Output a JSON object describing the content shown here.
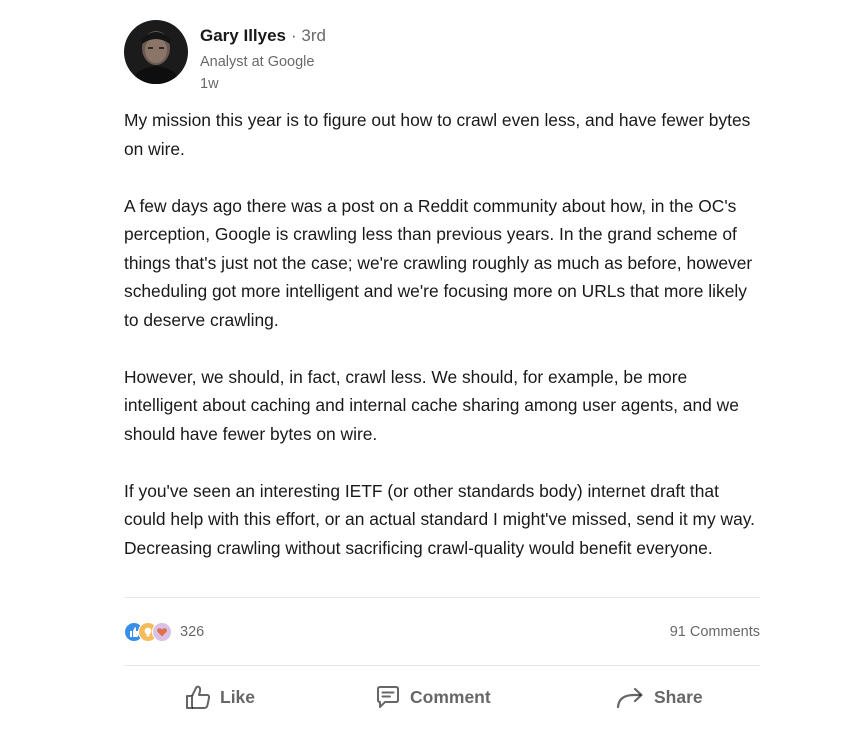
{
  "author": {
    "name": "Gary Illyes",
    "degree": "· 3rd",
    "headline": "Analyst at Google",
    "time": "1w"
  },
  "post": {
    "paragraphs": [
      "My mission this year is to figure out how to crawl even less, and have fewer bytes on wire.",
      "A few days ago there was a post on a Reddit community about how, in the OC's perception, Google is crawling less than previous years. In the grand scheme of things that's just not the case; we're crawling roughly as much as before, however scheduling got more intelligent and we're focusing more on URLs that more likely to deserve crawling.",
      "However, we should, in fact, crawl less. We should, for example, be more intelligent about caching and internal cache sharing among user agents, and we should have fewer bytes on wire.",
      "If you've seen an interesting IETF (or other standards body) internet draft that could help with this effort, or an actual standard I might've missed, send it my way. Decreasing crawling without sacrificing crawl-quality would benefit everyone."
    ]
  },
  "social": {
    "reactions": [
      "like-icon",
      "insightful-icon",
      "love-icon"
    ],
    "reaction_count": "326",
    "comments": "91 Comments"
  },
  "actions": {
    "like": "Like",
    "comment": "Comment",
    "share": "Share"
  },
  "colors": {
    "like": "#378fe9",
    "insightful": "#f5bb5c",
    "love": "#df704d"
  }
}
